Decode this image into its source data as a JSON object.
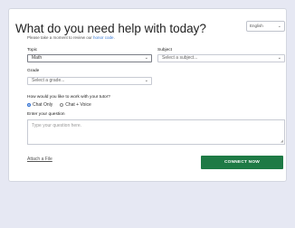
{
  "header": {
    "title": "What do you need help with today?",
    "subtitle_prefix": "Please take a moment to review our ",
    "subtitle_link": "honor code",
    "subtitle_suffix": ".",
    "language": "English"
  },
  "form": {
    "topic_label": "Topic",
    "topic_value": "Math",
    "subject_label": "Subject",
    "subject_placeholder": "Select a subject...",
    "grade_label": "Grade",
    "grade_placeholder": "Select a grade...",
    "mode_question": "How would you like to work with your tutor?",
    "mode_options": [
      "Chat Only",
      "Chat + Voice"
    ],
    "mode_selected": "Chat Only",
    "question_label": "Enter your question",
    "question_placeholder": "Type your question here."
  },
  "footer": {
    "attach_label": "Attach a File",
    "connect_label": "CONNECT NOW"
  },
  "colors": {
    "page_background": "#e6e8f3",
    "connect_button": "#1e7a45",
    "link": "#3a7bd5",
    "radio_selected": "#2f6fd1"
  }
}
